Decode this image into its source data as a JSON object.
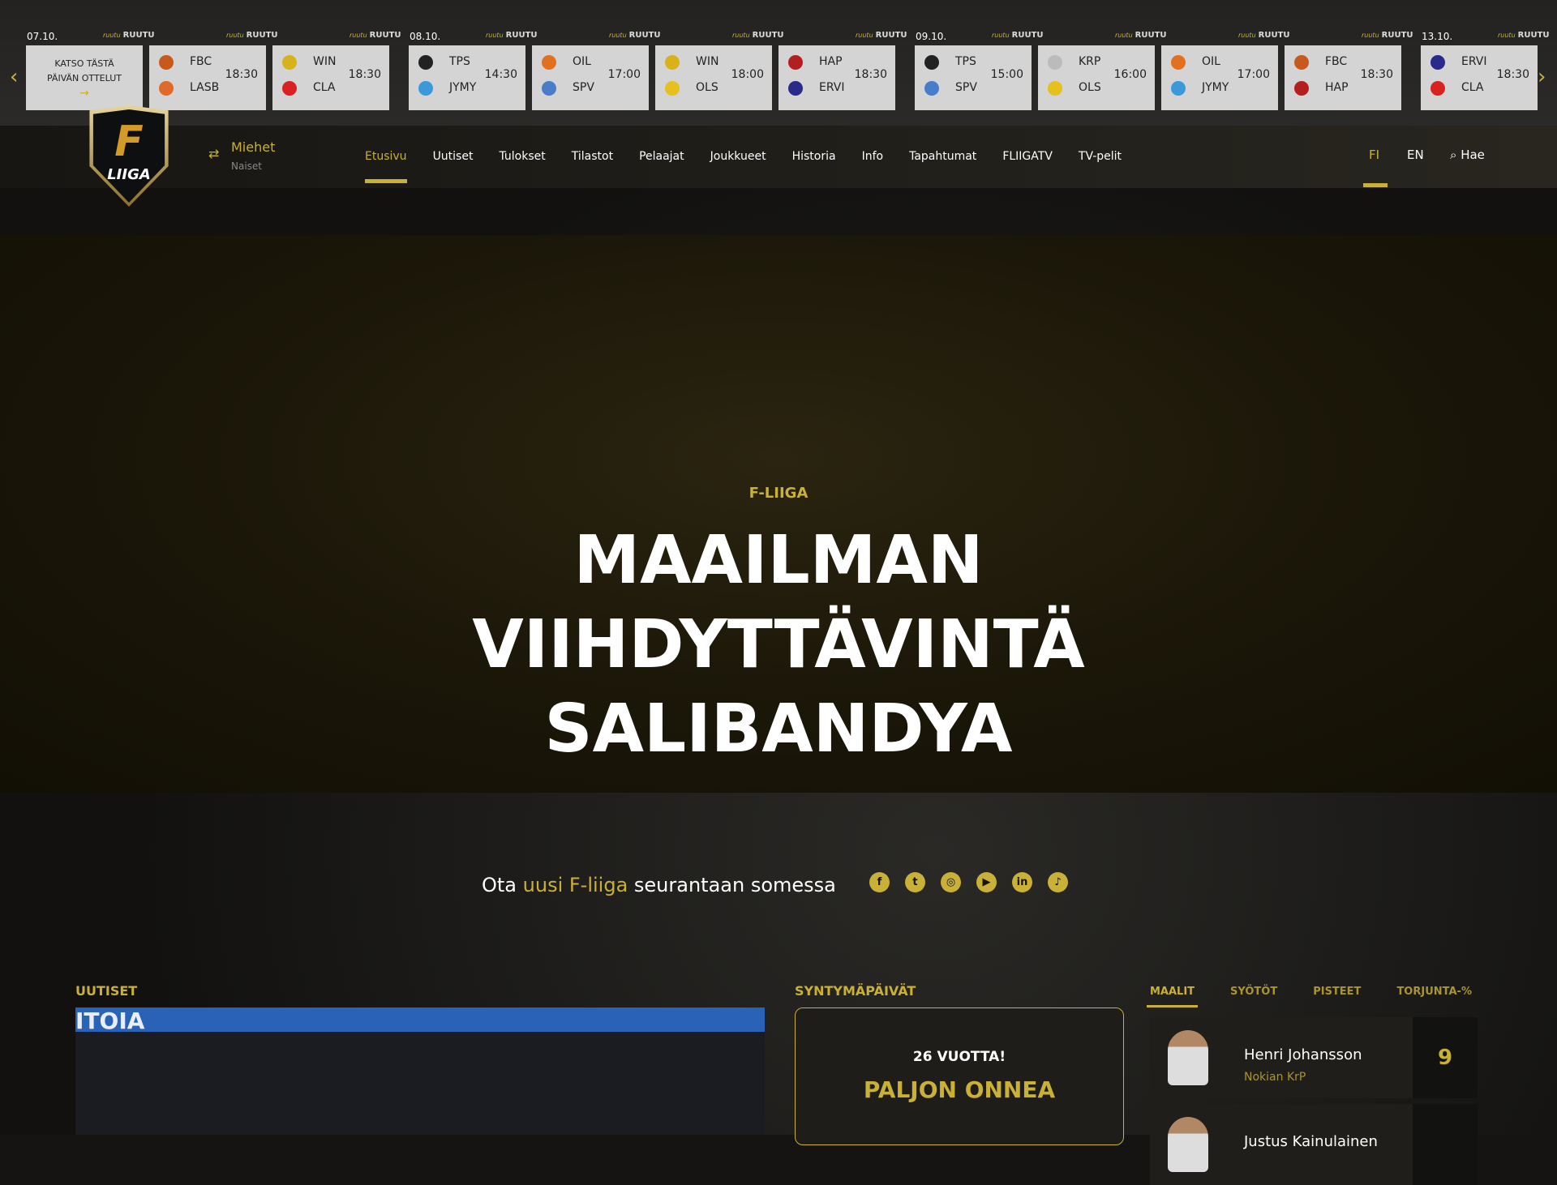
{
  "ticker": {
    "prev_label": "‹",
    "next_label": "›",
    "broadcaster": "RUUTU",
    "broadcaster_prefix": "ruutu",
    "dates": [
      "07.10.",
      "08.10.",
      "09.10.",
      "13.10."
    ],
    "katso": "KATSO TÄSTÄ PÄIVÄN OTTELUT",
    "katso_arrow": "→",
    "games": [
      {
        "home": "FBC",
        "away": "LASB",
        "time": "18:30",
        "hc": "#c8591d",
        "ac": "#e06a2a"
      },
      {
        "home": "WIN",
        "away": "CLA",
        "time": "18:30",
        "hc": "#d8b21a",
        "ac": "#d92121"
      },
      {
        "home": "TPS",
        "away": "JYMY",
        "time": "14:30",
        "hc": "#222222",
        "ac": "#3a9ad8"
      },
      {
        "home": "OIL",
        "away": "SPV",
        "time": "17:00",
        "hc": "#e2711f",
        "ac": "#4a7dc9"
      },
      {
        "home": "WIN",
        "away": "OLS",
        "time": "18:00",
        "hc": "#d8b21a",
        "ac": "#e6c01d"
      },
      {
        "home": "HAP",
        "away": "ERVI",
        "time": "18:30",
        "hc": "#b51e1e",
        "ac": "#2a2a8a"
      },
      {
        "home": "TPS",
        "away": "SPV",
        "time": "15:00",
        "hc": "#222222",
        "ac": "#4a7dc9"
      },
      {
        "home": "KRP",
        "away": "OLS",
        "time": "16:00",
        "hc": "#bbbbbb",
        "ac": "#e6c01d"
      },
      {
        "home": "OIL",
        "away": "JYMY",
        "time": "17:00",
        "hc": "#e2711f",
        "ac": "#3a9ad8"
      },
      {
        "home": "FBC",
        "away": "HAP",
        "time": "18:30",
        "hc": "#c8591d",
        "ac": "#b51e1e"
      },
      {
        "home": "ERVI",
        "away": "CLA",
        "time": "18:30",
        "hc": "#2a2a8a",
        "ac": "#d92121"
      }
    ]
  },
  "nav": {
    "logo": "LIIGA",
    "logo_letter": "F",
    "switch_icon": "⇄",
    "league_active": "Miehet",
    "league_other": "Naiset",
    "items": [
      "Etusivu",
      "Uutiset",
      "Tulokset",
      "Tilastot",
      "Pelaajat",
      "Joukkueet",
      "Historia",
      "Info",
      "Tapahtumat",
      "FLIIGATV",
      "TV-pelit"
    ],
    "lang_fi": "FI",
    "lang_en": "EN",
    "search_icon": "⌕",
    "search_label": "Hae"
  },
  "hero": {
    "kicker": "F-LIIGA",
    "title_lines": [
      "MAAILMAN",
      "VIIHDYTTÄVINTÄ",
      "SALIBANDYA"
    ]
  },
  "social": {
    "pre": "Ota ",
    "highlight": "uusi F-liiga",
    "post": " seurantaan somessa",
    "icons": [
      {
        "name": "facebook",
        "g": "f"
      },
      {
        "name": "twitter",
        "g": "t"
      },
      {
        "name": "instagram",
        "g": "◎"
      },
      {
        "name": "youtube",
        "g": "▶"
      },
      {
        "name": "linkedin",
        "g": "in"
      },
      {
        "name": "tiktok",
        "g": "♪"
      }
    ]
  },
  "news": {
    "heading": "UUTISET",
    "image_text": "ITOIA"
  },
  "birthdays": {
    "heading": "SYNTYMÄPÄIVÄT",
    "age": "26 VUOTTA!",
    "greeting": "PALJON ONNEA"
  },
  "stats": {
    "tabs": [
      "MAALIT",
      "SYÖTÖT",
      "PISTEET",
      "TORJUNTA-%"
    ],
    "rows": [
      {
        "name": "Henri Johansson",
        "team": "Nokian KrP",
        "value": "9"
      },
      {
        "name": "Justus Kainulainen"
      }
    ]
  },
  "colors": {
    "accent": "#c9b036"
  }
}
